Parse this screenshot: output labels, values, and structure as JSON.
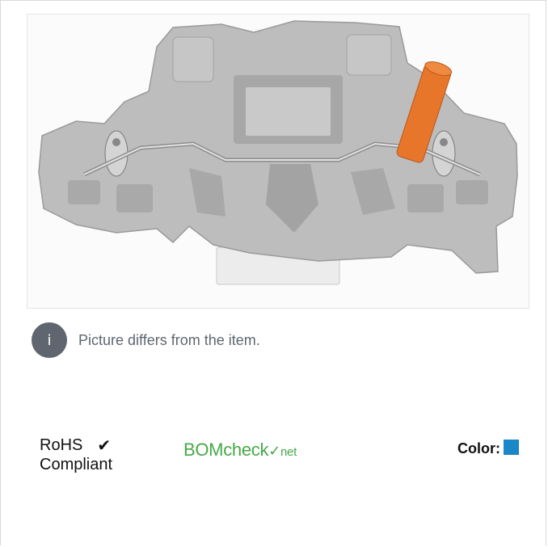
{
  "notice": {
    "icon": "info-icon",
    "icon_glyph": "i",
    "text": "Picture differs from the item."
  },
  "compliance": {
    "rohs_line1": "RoHS",
    "rohs_line2": "Compliant",
    "check_glyph": "✔",
    "bom_main": "BOMcheck",
    "bom_mark": "✓",
    "bom_net": "net"
  },
  "color": {
    "label": "Color:",
    "swatch_color": "#1a87c9"
  },
  "image": {
    "subject": "gray terminal block with orange lever",
    "colors": {
      "body": "#bcbcbc",
      "lever": "#e8762a",
      "clip": "#e6e6e6"
    }
  }
}
